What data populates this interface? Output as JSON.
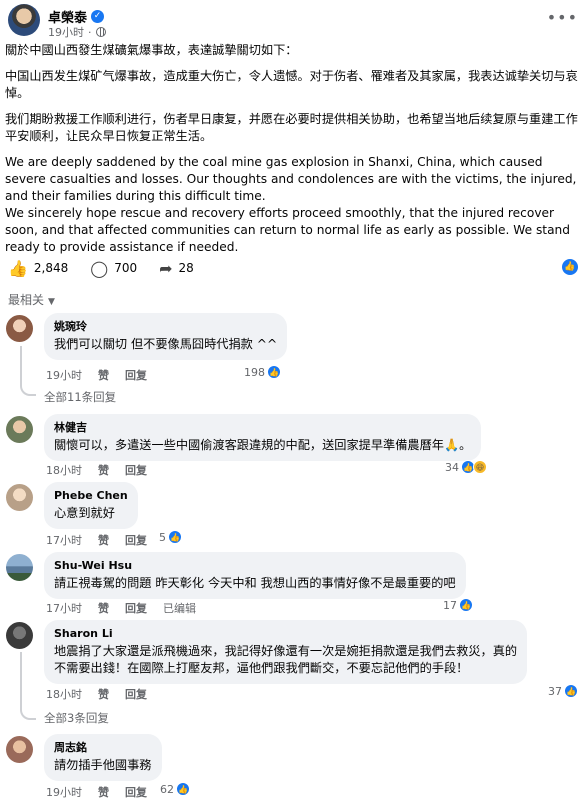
{
  "post": {
    "author": "卓榮泰",
    "time": "19小时",
    "paragraphs": [
      "關於中國山西發生煤礦氣爆事故，表達誠摯關切如下：",
      "中国山西发生煤矿气爆事故，造成重大伤亡，令人遗憾。对于伤者、罹难者及其家属，我表达诚挚关切与哀悼。",
      "我们期盼救援工作顺利进行，伤者早日康复，并愿在必要时提供相关协助，也希望当地后续复原与重建工作平安顺利，让民众早日恢复正常生活。"
    ],
    "english_1": "We are deeply saddened by the coal mine gas explosion in Shanxi, China, which caused severe casualties and losses. Our thoughts and condolences are with the victims, the injured, and their families during this difficult time.",
    "english_2": "We sincerely hope rescue and recovery efforts proceed smoothly, that the injured recover soon, and that affected communities can return to normal life as early as possible. We stand ready to provide assistance if needed.",
    "likes": "2,848",
    "comments": "700",
    "shares": "28"
  },
  "sort_label": "最相关",
  "labels": {
    "like": "赞",
    "reply": "回复",
    "edited": "已编辑"
  },
  "comments": [
    {
      "name": "姚琬玲",
      "text": "我們可以關切 但不要像馬囧時代捐款 ^^",
      "time": "19小时",
      "count": "198",
      "replies": "全部11条回复",
      "avatar": "#8a5a44"
    },
    {
      "name": "林健吉",
      "text": "關懷可以，多遣送一些中國偷渡客跟違規的中配，送回家提早準備農曆年🙏。",
      "time": "18小时",
      "count": "34",
      "avatar": "#6b7a5a"
    },
    {
      "name": "Phebe Chen",
      "text": "心意到就好",
      "time": "17小时",
      "count": "5",
      "avatar": "#b8a088"
    },
    {
      "name": "Shu-Wei Hsu",
      "text": "請正視毒駕的問題 昨天彰化 今天中和 我想山西的事情好像不是最重要的吧",
      "time": "17小时",
      "count": "17",
      "avatar": "#5a7a9a"
    },
    {
      "name": "Sharon Li",
      "text_1": "地震捐了大家還是派飛機過來，我記得好像還有一次是婉拒捐款還是我們去救災，真的",
      "text_2": "不需要出錢！在國際上打壓友邦，逼他們跟我們斷交，不要忘記他們的手段！",
      "time": "18小时",
      "count": "37",
      "replies": "全部3条回复",
      "avatar": "#3a3a3a"
    },
    {
      "name": "周志銘",
      "text": "請勿插手他國事務",
      "time": "19小时",
      "count": "62",
      "avatar": "#9a6a5a"
    }
  ]
}
